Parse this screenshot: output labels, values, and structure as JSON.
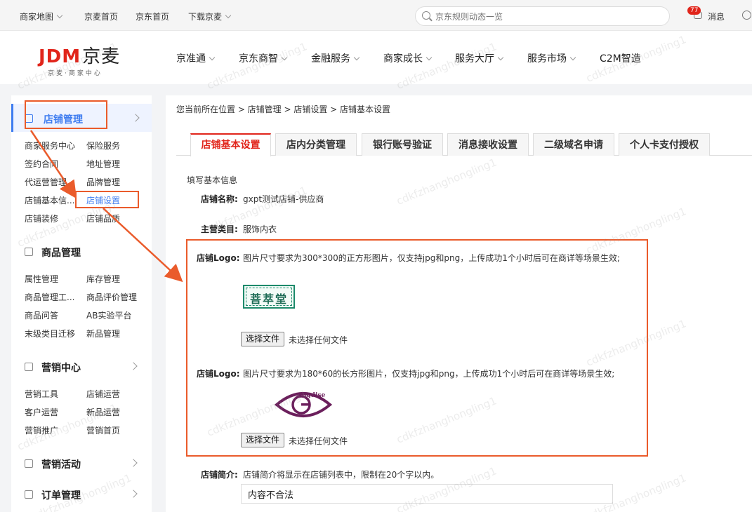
{
  "topbar": {
    "items": [
      "商家地图",
      "京麦首页",
      "京东首页",
      "下载京麦"
    ],
    "search_placeholder": "京东规则动态一览",
    "badge_count": "77",
    "messages_label": "消息"
  },
  "header": {
    "logo_main_jd": "JDM",
    "logo_main_cn": "京麦",
    "logo_sub": "京麦·商家中心",
    "nav": [
      "京准通",
      "京东商智",
      "金融服务",
      "商家成长",
      "服务大厅",
      "服务市场",
      "C2M智造"
    ]
  },
  "sidebar": {
    "sections": [
      {
        "label": "店铺管理",
        "items": [
          "商家服务中心",
          "保险服务",
          "签约合同",
          "地址管理",
          "代运营管理",
          "品牌管理",
          "店铺基本信...",
          "店铺设置",
          "店铺装修",
          "店铺品质"
        ]
      },
      {
        "label": "商品管理",
        "items": [
          "属性管理",
          "库存管理",
          "商品管理工...",
          "商品评价管理",
          "商品问答",
          "AB实验平台",
          "末级类目迁移",
          "新品管理"
        ]
      },
      {
        "label": "营销中心",
        "items": [
          "营销工具",
          "店铺运营",
          "客户运营",
          "新品运营",
          "营销推广",
          "营销首页"
        ]
      },
      {
        "label": "营销活动",
        "items": []
      },
      {
        "label": "订单管理",
        "items": []
      }
    ]
  },
  "main": {
    "breadcrumb": "您当前所在位置 > 店铺管理 > 店铺设置 > 店铺基本设置",
    "tabs": [
      "店铺基本设置",
      "店内分类管理",
      "银行账号验证",
      "消息接收设置",
      "二级域名申请",
      "个人卡支付授权"
    ],
    "form_title": "填写基本信息",
    "store_name_label": "店铺名称:",
    "store_name_value": "gxpt测试店铺-供应商",
    "category_label": "主营类目:",
    "category_value": "服饰内衣",
    "logo1_label": "店铺Logo:",
    "logo1_hint": "图片尺寸要求为300*300的正方形图片，仅支持jpg和png，上传成功1个小时后可在商详等场景生效;",
    "logo1_image_text": "菩萃堂",
    "logo2_label": "店铺Logo:",
    "logo2_hint": "图片尺寸要求为180*60的长方形图片，仅支持jpg和png，上传成功1个小时后可在商详等场景生效;",
    "logo2_image_text": "angdise",
    "file_button": "选择文件",
    "file_none": "未选择任何文件",
    "intro_label": "店铺简介:",
    "intro_hint": "店铺简介将显示在店铺列表中，限制在20个字以内。",
    "intro_value": "内容不合法"
  },
  "watermark": "cdkfzhanghongling1",
  "colors": {
    "accent": "#e1251b",
    "blue": "#3f7df0",
    "highlight": "#ea5b2b"
  }
}
